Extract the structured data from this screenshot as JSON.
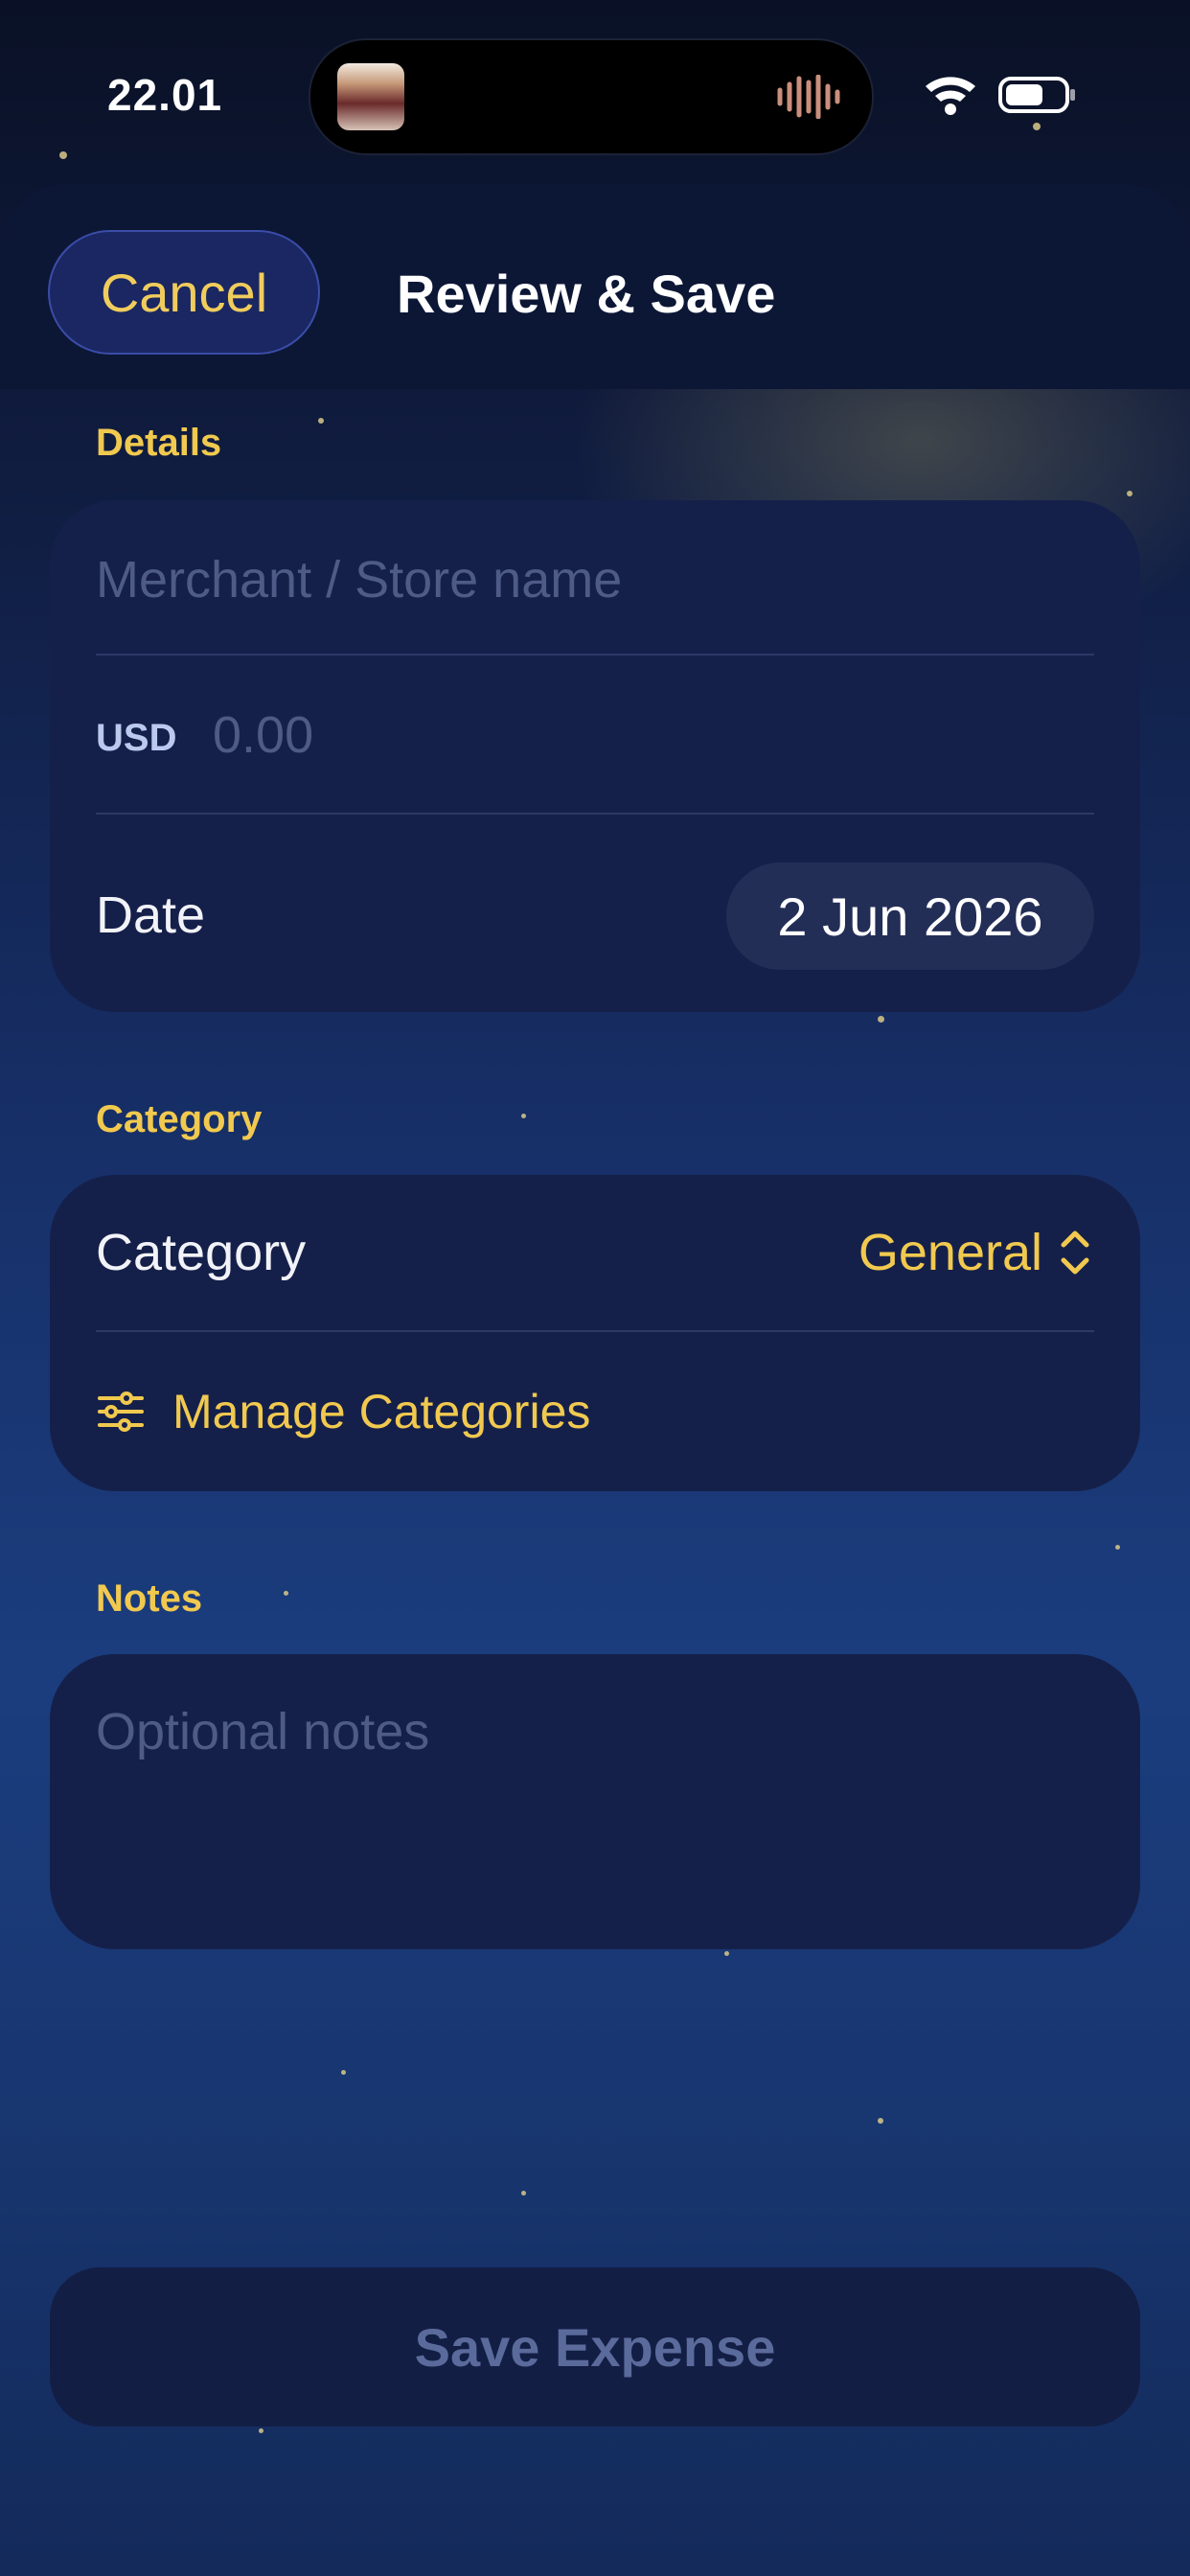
{
  "status_bar": {
    "time": "22.01"
  },
  "header": {
    "cancel_label": "Cancel",
    "title": "Review & Save"
  },
  "details": {
    "section_label": "Details",
    "merchant_placeholder": "Merchant / Store name",
    "currency": "USD",
    "amount_placeholder": "0.00",
    "date_label": "Date",
    "date_value": "2 Jun 2026"
  },
  "category": {
    "section_label": "Category",
    "row_label": "Category",
    "selected_value": "General",
    "manage_label": "Manage Categories"
  },
  "notes": {
    "section_label": "Notes",
    "placeholder": "Optional notes"
  },
  "save_label": "Save Expense",
  "colors": {
    "accent_gold": "#f1c94f",
    "card": "#15204a",
    "header": "#0c1736"
  },
  "icons": [
    "wifi-icon",
    "battery-icon",
    "waveform-icon",
    "sliders-icon",
    "chevron-up-down-icon"
  ]
}
